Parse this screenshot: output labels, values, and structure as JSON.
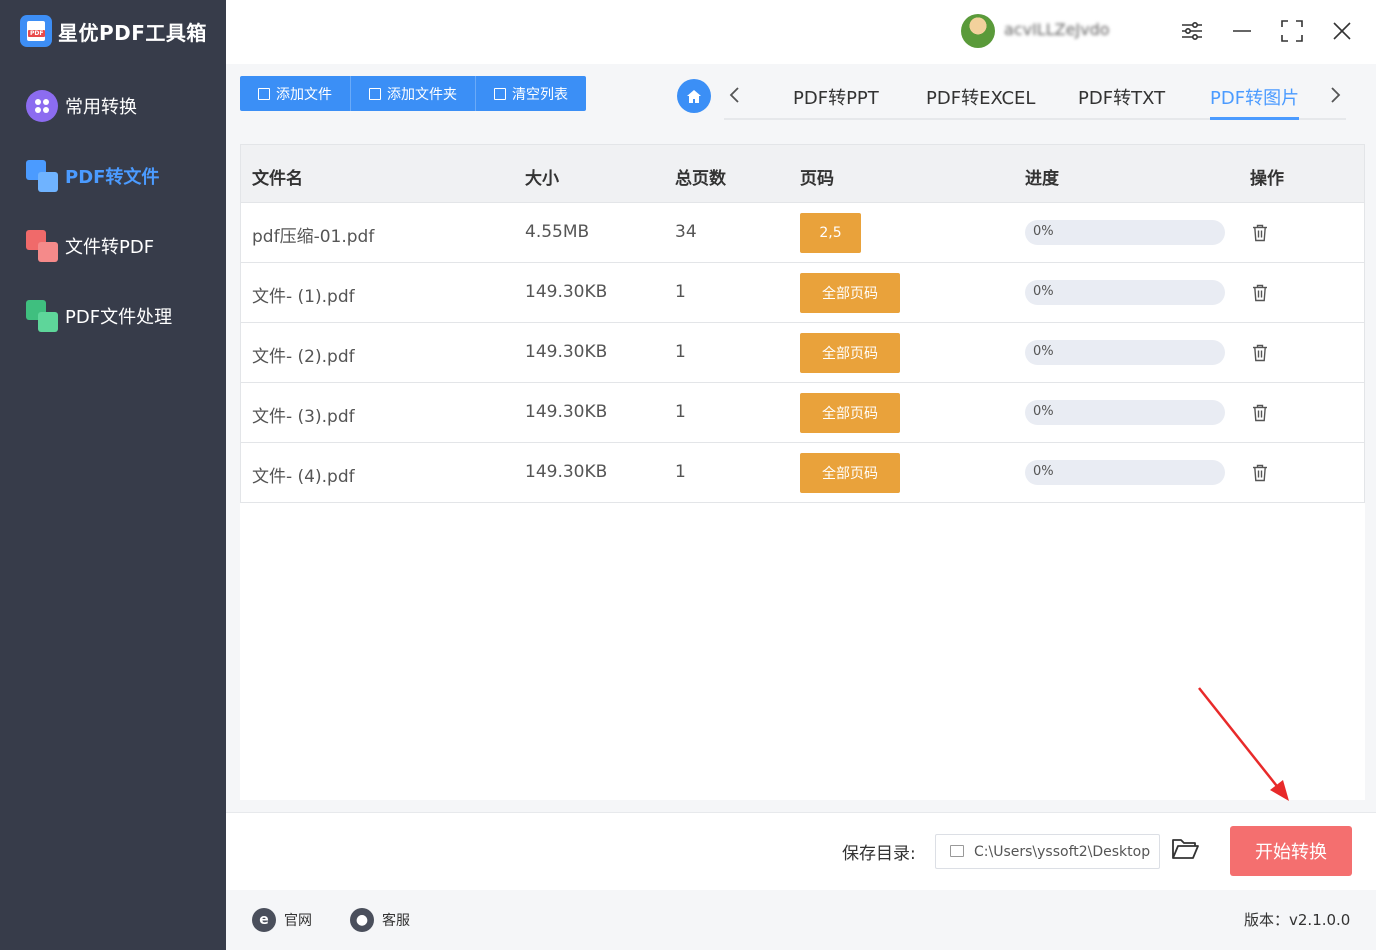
{
  "app": {
    "title": "星优PDF工具箱"
  },
  "sidebar": {
    "items": [
      {
        "label": "常用转换",
        "icon": "apps-icon",
        "active": false
      },
      {
        "label": "PDF转文件",
        "icon": "pdf-to-file-icon",
        "active": true
      },
      {
        "label": "文件转PDF",
        "icon": "file-to-pdf-icon",
        "active": false
      },
      {
        "label": "PDF文件处理",
        "icon": "pdf-process-icon",
        "active": false
      }
    ]
  },
  "topbar": {
    "username": "acvILLZeJvdo",
    "icons": [
      "settings-sliders-icon",
      "minimize-icon",
      "maximize-icon",
      "close-icon"
    ]
  },
  "toolbar": {
    "add_file": "添加文件",
    "add_folder": "添加文件夹",
    "clear_list": "清空列表"
  },
  "tabs": {
    "items": [
      {
        "label": "PDF转PPT",
        "active": false
      },
      {
        "label": "PDF转EXCEL",
        "active": false
      },
      {
        "label": "PDF转TXT",
        "active": false
      },
      {
        "label": "PDF转图片",
        "active": true
      }
    ]
  },
  "table": {
    "headers": {
      "name": "文件名",
      "size": "大小",
      "pages": "总页数",
      "page_range": "页码",
      "progress": "进度",
      "action": "操作"
    },
    "rows": [
      {
        "name": "pdf压缩-01.pdf",
        "size": "4.55MB",
        "pages": "34",
        "page_range": "2,5",
        "progress": "0%",
        "progress_value": 0
      },
      {
        "name": "文件- (1).pdf",
        "size": "149.30KB",
        "pages": "1",
        "page_range": "全部页码",
        "progress": "0%",
        "progress_value": 0
      },
      {
        "name": "文件- (2).pdf",
        "size": "149.30KB",
        "pages": "1",
        "page_range": "全部页码",
        "progress": "0%",
        "progress_value": 0
      },
      {
        "name": "文件- (3).pdf",
        "size": "149.30KB",
        "pages": "1",
        "page_range": "全部页码",
        "progress": "0%",
        "progress_value": 0
      },
      {
        "name": "文件- (4).pdf",
        "size": "149.30KB",
        "pages": "1",
        "page_range": "全部页码",
        "progress": "0%",
        "progress_value": 0
      }
    ]
  },
  "save": {
    "label": "保存目录:",
    "path": "C:\\Users\\yssoft2\\Desktop"
  },
  "start_button": "开始转换",
  "footer": {
    "website": "官网",
    "support": "客服",
    "version": "版本：v2.1.0.0"
  },
  "colors": {
    "sidebar_bg": "#373c4a",
    "accent": "#3b8ff6",
    "page_button": "#e9a23b",
    "start_button": "#f46f6f"
  }
}
